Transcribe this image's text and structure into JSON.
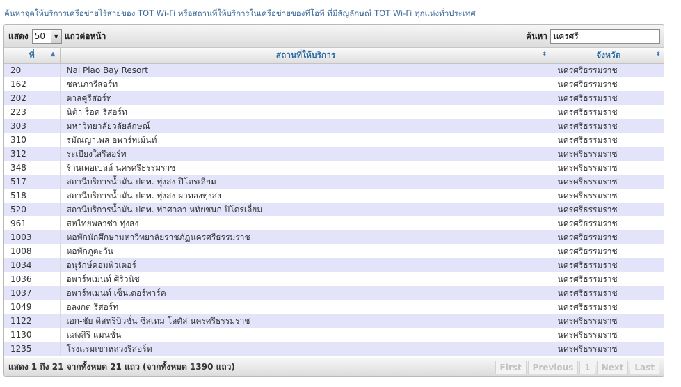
{
  "intro_text": "ค้นหาจุดให้บริการเครือข่ายไร้สายของ TOT Wi-Fi หรือสถานที่ให้บริการในเครือข่ายของทีโอที ที่มีสัญลักษณ์ TOT Wi-Fi ทุกแห่งทั่วประเทศ",
  "toolbar": {
    "show_label": "แสดง",
    "page_size": "50",
    "rows_per_page_label": "แถวต่อหน้า",
    "search_label": "ค้นหา",
    "search_value": "นครศรี"
  },
  "columns": {
    "id": "ที่",
    "place": "สถานที่ให้บริการ",
    "province": "จังหวัด"
  },
  "rows": [
    {
      "id": "20",
      "name": "Nai Plao Bay Resort",
      "province": "นครศรีธรรมราช"
    },
    {
      "id": "162",
      "name": "ชลนภารีสอร์ท",
      "province": "นครศรีธรรมราช"
    },
    {
      "id": "202",
      "name": "ตาลคู่รีสอร์ท",
      "province": "นครศรีธรรมราช"
    },
    {
      "id": "223",
      "name": "นิต้า ร็อค รีสอร์ท",
      "province": "นครศรีธรรมราช"
    },
    {
      "id": "303",
      "name": "มหาวิทยาลัยวลัยลักษณ์",
      "province": "นครศรีธรรมราช"
    },
    {
      "id": "310",
      "name": "รมัณญาเพส อพาร์ทเม้นท์",
      "province": "นครศรีธรรมราช"
    },
    {
      "id": "312",
      "name": "ระเบียงใสรีสอร์ท",
      "province": "นครศรีธรรมราช"
    },
    {
      "id": "348",
      "name": "ร้านเดอเบลล์ นครศรีธรรมราช",
      "province": "นครศรีธรรมราช"
    },
    {
      "id": "517",
      "name": "สถานีบริการน้ำมัน ปตท. ทุ่งสง ปิโตรเลี่ยม",
      "province": "นครศรีธรรมราช"
    },
    {
      "id": "518",
      "name": "สถานีบริการน้ำมัน ปตท. ทุ่งสง ผาทองทุ่งสง",
      "province": "นครศรีธรรมราช"
    },
    {
      "id": "520",
      "name": "สถานีบริการน้ำมัน ปตท. ท่าศาลา หทัยชนก ปิโตรเลี่ยม",
      "province": "นครศรีธรรมราช"
    },
    {
      "id": "961",
      "name": "สหไทยพลาซ่า ทุ่งสง",
      "province": "นครศรีธรรมราช"
    },
    {
      "id": "1003",
      "name": "หอพักนักศึกษามหาวิทยาลัยราชภัฏนครศรีธรรมราช",
      "province": "นครศรีธรรมราช"
    },
    {
      "id": "1008",
      "name": "หอพักภูตะวัน",
      "province": "นครศรีธรรมราช"
    },
    {
      "id": "1034",
      "name": "อนุรักษ์คอมพิวเตอร์",
      "province": "นครศรีธรรมราช"
    },
    {
      "id": "1036",
      "name": "อพาร์ทเมนท์ ศิริวนิช",
      "province": "นครศรีธรรมราช"
    },
    {
      "id": "1037",
      "name": "อพาร์ทเมนท์ เซ็นเตอร์พาร์ค",
      "province": "นครศรีธรรมราช"
    },
    {
      "id": "1049",
      "name": "อลงกต รีสอร์ท",
      "province": "นครศรีธรรมราช"
    },
    {
      "id": "1122",
      "name": "เอก-ชัย ดิสทริบิวชั่น ซิสเทม โลตัส นครศรีธรรมราช",
      "province": "นครศรีธรรมราช"
    },
    {
      "id": "1130",
      "name": "แสงสิริ แมนชั่น",
      "province": "นครศรีธรรมราช"
    },
    {
      "id": "1235",
      "name": "โรงแรมเขาหลวงรีสอร์ท",
      "province": "นครศรีธรรมราช"
    }
  ],
  "footer": {
    "info": "แสดง 1 ถึง 21 จากทั้งหมด 21 แถว (จากทั้งหมด 1390 แถว)",
    "first": "First",
    "previous": "Previous",
    "page": "1",
    "next": "Next",
    "last": "Last"
  },
  "icons": {
    "select_arrow": "triangle-down",
    "sort_asc": "triangle-up-down",
    "sort_both": "double-chevron"
  },
  "colors": {
    "link_blue": "#2b6ca3",
    "row_odd": "#e3e4fa",
    "row_even": "#ffffff"
  }
}
